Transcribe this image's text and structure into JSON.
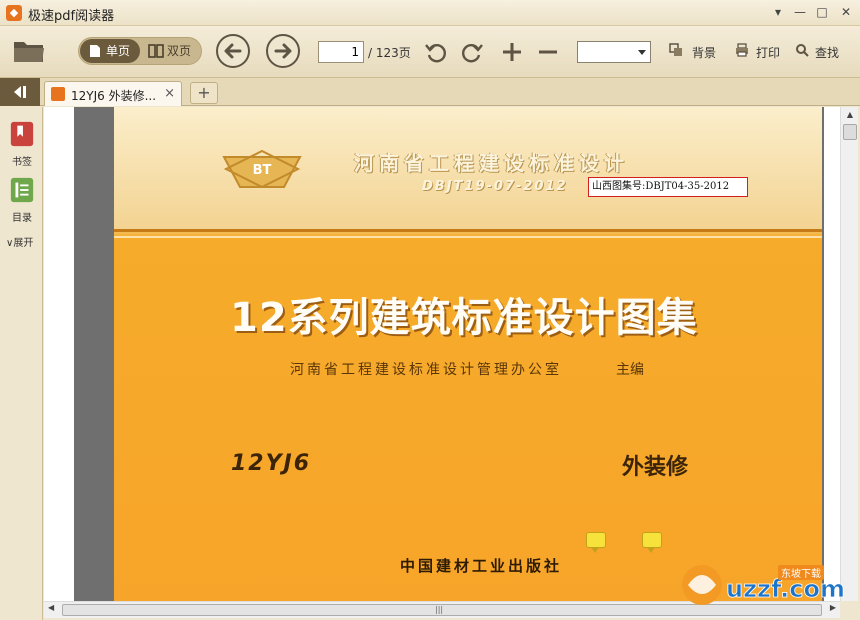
{
  "window": {
    "title": "极速pdf阅读器",
    "controls": {
      "menu": "▾",
      "minimize": "—",
      "maximize": "□",
      "close": "✕"
    }
  },
  "toolbar": {
    "open_icon": "folder-icon",
    "view_single_label": "单页",
    "view_double_label": "双页",
    "current_page": "1",
    "total_pages": "/ 123页",
    "zoom_value": "",
    "background_label": "背景",
    "print_label": "打印",
    "find_label": "查找"
  },
  "tabs": {
    "active_tab_label": "12YJ6 外装修...",
    "close_symbol": "×",
    "new_tab_symbol": "+"
  },
  "sidebar": {
    "bookmarks_label": "书签",
    "toc_label": "目录",
    "expand_label": "展开"
  },
  "document": {
    "logo_text": "BT",
    "header_title": "河南省工程建设标准设计",
    "header_code": "DBJT19-07-2012",
    "stamp_text": "山西图集号:DBJT04-35-2012",
    "main_title": "12系列建筑标准设计图集",
    "subtitle": "河南省工程建设标准设计管理办公室",
    "subtitle_role": "主编",
    "code": "12YJ6",
    "category": "外装修",
    "publisher": "中国建材工业出版社"
  },
  "scrollbars": {
    "grip": "|||"
  },
  "watermark": {
    "text": "uzzf.com",
    "caption": "东坡下载"
  },
  "colors": {
    "accent_orange": "#e8731f",
    "toolbar_bg": "#efe6d0",
    "page_orange": "#f7a52a",
    "stamp_border": "#d21f1f"
  }
}
